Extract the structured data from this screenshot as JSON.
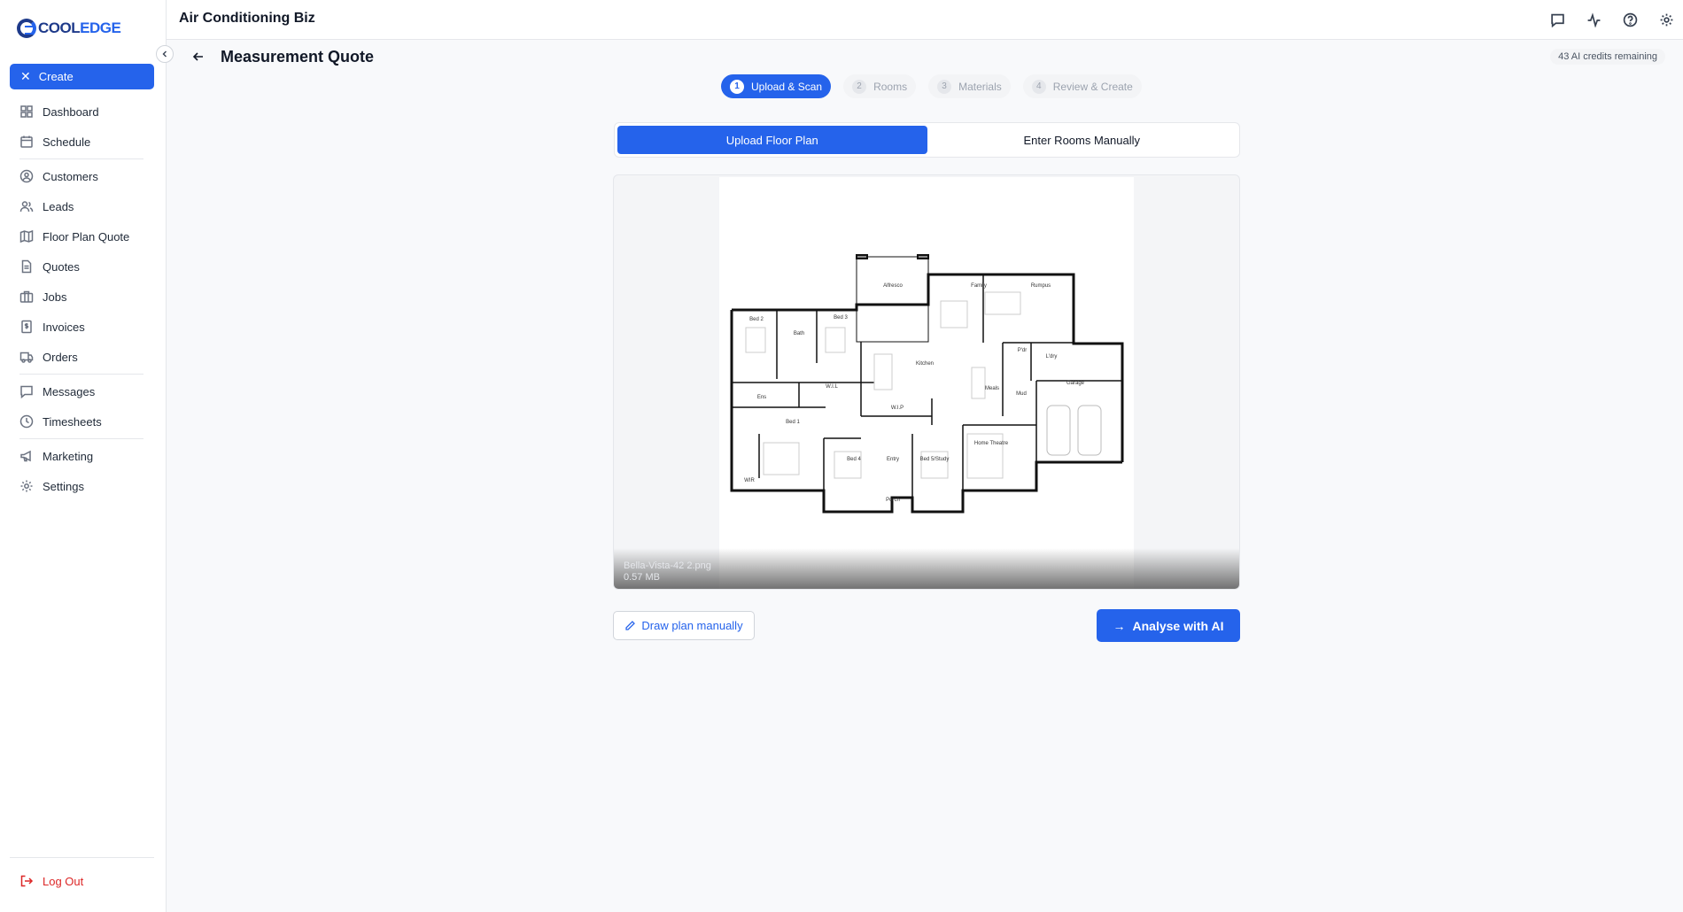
{
  "brand": {
    "part1": "COOL",
    "part2": "EDGE"
  },
  "sidebar": {
    "create_label": "Create",
    "items": [
      {
        "label": "Dashboard",
        "icon": "dashboard-icon"
      },
      {
        "label": "Schedule",
        "icon": "calendar-icon"
      },
      {
        "label": "Customers",
        "icon": "user-circle-icon"
      },
      {
        "label": "Leads",
        "icon": "users-icon"
      },
      {
        "label": "Floor Plan Quote",
        "icon": "map-icon"
      },
      {
        "label": "Quotes",
        "icon": "document-icon"
      },
      {
        "label": "Jobs",
        "icon": "briefcase-icon"
      },
      {
        "label": "Invoices",
        "icon": "invoice-icon"
      },
      {
        "label": "Orders",
        "icon": "truck-icon"
      },
      {
        "label": "Messages",
        "icon": "message-icon"
      },
      {
        "label": "Timesheets",
        "icon": "clock-icon"
      },
      {
        "label": "Marketing",
        "icon": "megaphone-icon"
      },
      {
        "label": "Settings",
        "icon": "gear-icon"
      }
    ],
    "logout_label": "Log Out"
  },
  "header": {
    "title": "Air Conditioning Biz"
  },
  "page": {
    "title": "Measurement Quote",
    "credits": "43 AI credits remaining"
  },
  "steps": [
    {
      "num": "1",
      "label": "Upload & Scan"
    },
    {
      "num": "2",
      "label": "Rooms"
    },
    {
      "num": "3",
      "label": "Materials"
    },
    {
      "num": "4",
      "label": "Review & Create"
    }
  ],
  "tabs": {
    "upload": "Upload Floor Plan",
    "manual": "Enter Rooms Manually"
  },
  "file": {
    "name": "Bella-Vista-42 2.png",
    "size": "0.57 MB"
  },
  "floorplan": {
    "rooms": [
      "Alfresco",
      "Family",
      "Rumpus",
      "Bed 2",
      "Bath",
      "Bed 3",
      "Kitchen",
      "P'dr",
      "L'dry",
      "Garage",
      "Ens",
      "W.I.L",
      "Meals",
      "Mud",
      "Bed 1",
      "W.I.P",
      "Home Theatre",
      "Bed 4",
      "Entry",
      "Bed 5/Study",
      "Porch",
      "WIR"
    ]
  },
  "actions": {
    "draw_label": "Draw plan manually",
    "analyse_label": "Analyse with AI"
  },
  "colors": {
    "accent": "#2563eb",
    "danger": "#dc2626"
  }
}
